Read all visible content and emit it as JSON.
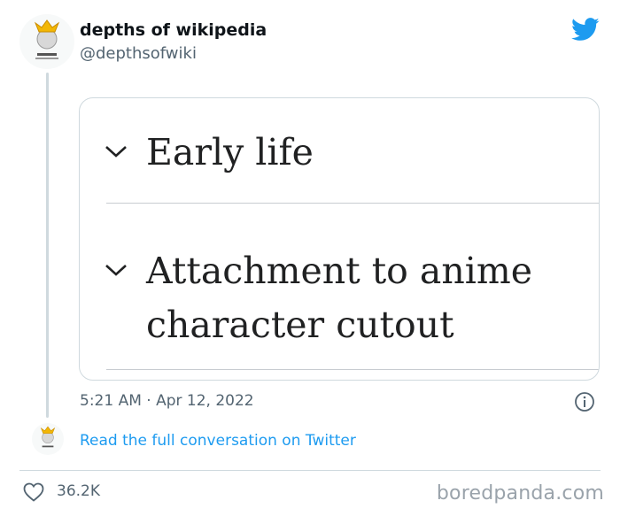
{
  "tweet": {
    "display_name": "depths of wikipedia",
    "handle": "@depthsofwiki",
    "avatar_icon": "wikipedia-crown-icon",
    "timestamp": "5:21 AM · Apr 12, 2022"
  },
  "media": {
    "sections": [
      {
        "icon": "chevron-down-icon",
        "title_line1": "Early life",
        "title_line2": ""
      },
      {
        "icon": "chevron-down-icon",
        "title_line1": "Attachment to anime",
        "title_line2": "character cutout"
      }
    ]
  },
  "footer": {
    "conversation_link": "Read the full conversation on Twitter",
    "like_count": "36.2K",
    "watermark": "boredpanda.com"
  },
  "colors": {
    "link": "#1d9bf0",
    "muted": "#536471",
    "twitter_blue": "#1d9bf0"
  }
}
